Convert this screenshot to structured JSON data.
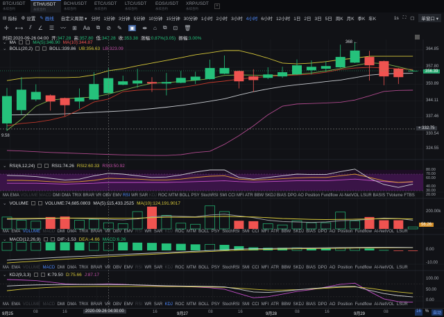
{
  "tabs": [
    {
      "pair": "BTC/USDT",
      "sub": "永续合约"
    },
    {
      "pair": "ETH/USDT",
      "sub": "永续合约",
      "active": true
    },
    {
      "pair": "BCH/USDT",
      "sub": "永续合约"
    },
    {
      "pair": "ETC/USDT",
      "sub": "永续合约"
    },
    {
      "pair": "LTC/USDT",
      "sub": "永续合约"
    },
    {
      "pair": "EOS/USDT",
      "sub": "永续合约"
    },
    {
      "pair": "XRP/USDT",
      "sub": "永续合约"
    }
  ],
  "toolbar": {
    "indicator": "指标",
    "settings": "设置",
    "draw": "画线",
    "custom_period": "自定义周期 ▾",
    "periods": [
      "分时",
      "1分钟",
      "3分钟",
      "5分钟",
      "10分钟",
      "15分钟",
      "30分钟",
      "1小时",
      "2小时",
      "3小时",
      "4小时",
      "6小时",
      "12小时",
      "1日",
      "2日",
      "3日",
      "5日",
      "周K",
      "月K",
      "季K",
      "年K"
    ],
    "active_period": "4小时",
    "interval": "1s",
    "window_mode": "单窗口 ▾"
  },
  "draw_tools": [
    "✛",
    "⟷",
    "⫽",
    "∠",
    "☰",
    "〰",
    "⊞",
    "Aa",
    "⧉",
    "⊘",
    "✎",
    "▣",
    "⇼",
    "⌂",
    "⧉",
    "⊡",
    "🗑"
  ],
  "info": {
    "time_label": "时间:",
    "time": "2020-09-26 04:00",
    "open_label": "开:",
    "open": "347.28",
    "high_label": "高:",
    "high": "357.80",
    "low_label": "低:",
    "low": "347.28",
    "close_label": "收:",
    "close": "353.38",
    "change_label": "涨幅:",
    "change": "0.87%(3.05)",
    "amp_label": "振幅:",
    "amp": "3.00%"
  },
  "ma_legend": {
    "name": "MA",
    "ma5": "MA(5):346.90",
    "ma10": "MA(10):344.87"
  },
  "boll_legend": {
    "name": "BOLL(20,2)",
    "boll": "BOLL:339.86",
    "ub": "UB:356.63",
    "lb": "LB:323.09"
  },
  "rsi_legend": {
    "name": "RSI(6,12,24)",
    "r1": "RSI1:74.26",
    "r2": "RSI2:60.33",
    "r3": "RSI3:50.92"
  },
  "vol_legend": {
    "name": "VOLUME",
    "v": "VOLUME:74,685.0803",
    "ma5": "MA(5):115,433.2525",
    "ma10": "MA(10):124,191.9017"
  },
  "macd_legend": {
    "name": "MACD(12,26,9)",
    "dif": "DIF:-1.53",
    "dea": "DEA:-4.66",
    "macd": "MACD:6.26"
  },
  "kdj_legend": {
    "name": "KDJ(9,3,3)",
    "k": "K:79.50",
    "d": "D:75.66",
    "j": "J:87.17"
  },
  "price_axis": [
    "364.85",
    "357.80",
    "350.89",
    "344.11",
    "337.46",
    "330.54",
    "324.55"
  ],
  "current_price": "356.39",
  "crosshair_price": "332.75",
  "high_marker": "368",
  "left_cut_label": "9.58",
  "rsi_axis": [
    "80.00",
    "70.00",
    "60.00",
    "40.00",
    "30.00",
    "20.00"
  ],
  "vol_axis": "200.00k",
  "vol_tag": "56.26",
  "macd_axis": [
    "0.00",
    "-10.00"
  ],
  "kdj_axis": [
    "100.00",
    "50.00",
    "0.00"
  ],
  "indicators": [
    "MA",
    "EMA",
    "VOLUME",
    "MACD",
    "DMI",
    "DMA",
    "TRIX",
    "BRAR",
    "VR",
    "OBV",
    "EMV",
    "RSI",
    "WR",
    "SAR",
    "KDJ",
    "ROC",
    "MTM",
    "BOLL",
    "PSY",
    "StochRSI",
    "SMI",
    "CCI",
    "MFI",
    "ATR",
    "BBW",
    "SKDJ",
    "BIAS",
    "DPO",
    "AO",
    "Position",
    "Fundflow",
    "AI-NetVOL",
    "LSUR",
    "BASIS",
    "TVolume",
    "FTBS"
  ],
  "time_axis": {
    "labels": [
      "9月25",
      "08",
      "16",
      "16",
      "9月27",
      "08",
      "16",
      "9月28",
      "08",
      "16",
      "9月29",
      "08"
    ],
    "crosshair": "2020-09-26 04:00:00",
    "right": "16",
    "pct": "%",
    "auto": "自动"
  },
  "colors": {
    "up": "#25c17b",
    "down": "#ef5350",
    "ub": "#d8c93a",
    "mid": "#c9ccd1",
    "lb": "#b04a8e",
    "ma5": "#7fb24a",
    "ma10": "#c0392b",
    "bg": "#111216",
    "accent": "#4f8cff"
  },
  "chart_data": {
    "type": "candlestick",
    "candles": [
      [
        335.0,
        349.4,
        332.0,
        346.1
      ],
      [
        340.4,
        353.8,
        338.5,
        348.7
      ],
      [
        344.7,
        350.9,
        344.0,
        347.8
      ],
      [
        346.4,
        346.8,
        340.2,
        343.9
      ],
      [
        345.3,
        345.5,
        337.9,
        342.4
      ],
      [
        343.9,
        349.2,
        341.0,
        345.5
      ],
      [
        344.7,
        355.8,
        344.5,
        351.0
      ],
      [
        347.28,
        357.8,
        347.28,
        353.38
      ],
      [
        350.7,
        354.4,
        350.5,
        352.1
      ],
      [
        351.2,
        357.2,
        349.5,
        352.4
      ],
      [
        351.8,
        353.8,
        347.8,
        351.2
      ],
      [
        351.2,
        355.5,
        346.4,
        351.8
      ],
      [
        351.5,
        356.3,
        351.3,
        353.5
      ],
      [
        352.5,
        356.0,
        351.0,
        354.0
      ],
      [
        353.0,
        360.9,
        352.8,
        357.5
      ],
      [
        355.2,
        362.6,
        355.0,
        357.5
      ],
      [
        356.3,
        356.5,
        349.2,
        352.1
      ],
      [
        354.1,
        357.0,
        347.8,
        352.6
      ],
      [
        353.5,
        357.8,
        353.0,
        354.9
      ],
      [
        354.1,
        358.0,
        353.5,
        355.8
      ],
      [
        354.9,
        361.0,
        354.7,
        358.6
      ],
      [
        356.6,
        360.6,
        354.9,
        358.0
      ],
      [
        357.2,
        360.3,
        356.0,
        358.3
      ],
      [
        357.8,
        367.0,
        357.6,
        362.0
      ],
      [
        359.7,
        368.0,
        359.5,
        364.6
      ],
      [
        362.0,
        364.5,
        352.4,
        358.6
      ],
      [
        360.3,
        360.5,
        350.5,
        354.1
      ],
      [
        357.2,
        357.5,
        351.0,
        353.8
      ],
      [
        356.39,
        356.8,
        356.0,
        356.39
      ]
    ],
    "ma5": [
      332.2,
      336.7,
      342.0,
      344.5,
      345.0,
      345.4,
      345.7,
      346.9,
      348.5,
      350.0,
      351.3,
      351.6,
      352.0,
      352.5,
      353.2,
      354.5,
      354.7,
      354.6,
      354.5,
      354.6,
      355.0,
      355.5,
      356.3,
      357.3,
      358.5,
      359.6,
      359.3,
      358.0,
      356.5
    ],
    "ma10": [
      334.0,
      335.0,
      335.5,
      336.4,
      337.8,
      340.6,
      343.7,
      344.9,
      347.9,
      348.5,
      348.8,
      348.8,
      349.6,
      350.5,
      351.6,
      352.2,
      353.0,
      353.6,
      354.1,
      354.4,
      354.7,
      355.0,
      355.8,
      356.9,
      357.5,
      357.8,
      357.5,
      357.2,
      356.9
    ],
    "ub": [
      352.4,
      353.3,
      353.6,
      353.6,
      353.6,
      353.8,
      354.7,
      356.4,
      357.2,
      358.4,
      359.5,
      360.6,
      361.7,
      362.9,
      363.7,
      364.6,
      364.6,
      363.2,
      361.5,
      359.5,
      359.2,
      359.5,
      360.1,
      360.9,
      361.5,
      362.3,
      362.3,
      362.3,
      362.3
    ],
    "mid": [
      338.4,
      338.5,
      338.6,
      338.7,
      338.9,
      339.2,
      339.5,
      339.8,
      340.1,
      340.5,
      341.0,
      341.6,
      342.3,
      343.1,
      344.0,
      345.0,
      346.5,
      347.9,
      349.0,
      350.0,
      350.7,
      351.3,
      352.0,
      352.6,
      353.6,
      354.6,
      355.1,
      355.3,
      355.4
    ],
    "lb": [
      324.0,
      323.8,
      323.5,
      323.2,
      323.0,
      322.8,
      322.6,
      322.4,
      322.2,
      322.1,
      322.0,
      322.0,
      322.3,
      323.2,
      323.7,
      326.5,
      330.0,
      334.0,
      338.5,
      342.0,
      342.9,
      343.1,
      343.3,
      343.6,
      344.5,
      346.2,
      348.0,
      348.4,
      348.5
    ],
    "price_range": [
      322.0,
      368.0
    ],
    "rsi1": [
      67,
      66,
      64,
      60,
      56,
      58,
      66,
      72,
      70,
      66,
      62,
      63,
      68,
      75,
      80,
      80,
      62,
      58,
      62,
      66,
      70,
      69,
      69,
      76,
      82,
      60,
      45,
      38,
      46
    ],
    "rsi2": [
      55,
      55,
      54,
      52,
      51,
      52,
      55,
      60,
      59,
      58,
      56,
      56,
      58,
      62,
      65,
      66,
      58,
      56,
      57,
      59,
      61,
      62,
      62,
      66,
      70,
      62,
      54,
      50,
      52
    ],
    "rsi3": [
      48,
      48,
      48,
      47,
      46,
      47,
      48,
      50,
      50,
      50,
      50,
      50,
      51,
      52,
      53,
      54,
      52,
      51,
      52,
      53,
      54,
      54,
      54,
      56,
      58,
      55,
      52,
      50,
      51
    ],
    "volume_k": [
      137,
      100,
      89,
      137,
      143,
      100,
      109,
      71,
      60,
      200,
      257,
      157,
      66,
      54,
      266,
      200,
      94,
      89,
      60,
      46,
      94,
      71,
      71,
      194,
      94,
      137,
      100,
      100,
      23
    ],
    "vol_ma5_k": [
      110,
      112,
      115,
      120,
      125,
      121,
      115,
      110,
      105,
      115,
      140,
      150,
      145,
      140,
      160,
      170,
      150,
      130,
      100,
      85,
      80,
      75,
      80,
      95,
      100,
      110,
      125,
      120,
      100
    ],
    "vol_ma10_k": [
      120,
      120,
      122,
      124,
      125,
      125,
      125,
      124,
      123,
      124,
      130,
      135,
      135,
      135,
      140,
      145,
      140,
      138,
      130,
      120,
      115,
      110,
      108,
      110,
      112,
      115,
      118,
      118,
      115
    ],
    "macd_hist": [
      6.2,
      6.2,
      6.2,
      6.2,
      6.2,
      6.2,
      6.2,
      6.2,
      6.2,
      5.9,
      5.7,
      5.3,
      5.0,
      4.6,
      4.6,
      4.2,
      3.2,
      2.3,
      2.0,
      2.0,
      2.0,
      1.6,
      1.6,
      1.8,
      1.8,
      1.4,
      0.3,
      -0.3,
      -0.3
    ],
    "macd_hollow": [
      0,
      1,
      2,
      6,
      7,
      14,
      20,
      23,
      24
    ],
    "dif": [
      -7.4,
      -6.8,
      -6.2,
      -5.6,
      -5.0,
      -4.5,
      -4.0,
      -3.5,
      -3.0,
      -2.5,
      -2.0,
      -1.6,
      -1.1,
      -0.6,
      -0.1,
      0.5,
      1.0,
      1.2,
      1.4,
      1.6,
      1.8,
      1.9,
      2.0,
      2.1,
      2.2,
      2.3,
      2.4,
      2.3,
      2.2
    ],
    "dea": [
      -9.5,
      -8.8,
      -8.1,
      -7.4,
      -6.7,
      -6.0,
      -5.4,
      -4.7,
      -4.1,
      -3.5,
      -2.9,
      -2.4,
      -1.8,
      -1.3,
      -0.8,
      -0.3,
      0.2,
      0.5,
      0.8,
      1.0,
      1.2,
      1.4,
      1.5,
      1.6,
      1.8,
      1.9,
      2.0,
      2.1,
      2.1
    ],
    "k": [
      70,
      73,
      75,
      76,
      77,
      77,
      77,
      77,
      76,
      75,
      73,
      71,
      70,
      69,
      68,
      66,
      55,
      42,
      40,
      45,
      52,
      58,
      63,
      68,
      68,
      50,
      35,
      25,
      19
    ],
    "d": [
      48,
      55,
      60,
      64,
      66,
      67,
      68,
      68,
      68,
      68,
      68,
      67,
      67,
      66,
      65,
      64,
      60,
      55,
      51,
      51,
      53,
      56,
      60,
      64,
      66,
      60,
      50,
      42,
      36
    ],
    "j": [
      100,
      98,
      95,
      88,
      80,
      78,
      78,
      80,
      78,
      74,
      72,
      70,
      68,
      65,
      62,
      55,
      35,
      15,
      20,
      32,
      45,
      53,
      65,
      78,
      83,
      45,
      10,
      -3,
      -5
    ],
    "crosshair_index": 7
  }
}
